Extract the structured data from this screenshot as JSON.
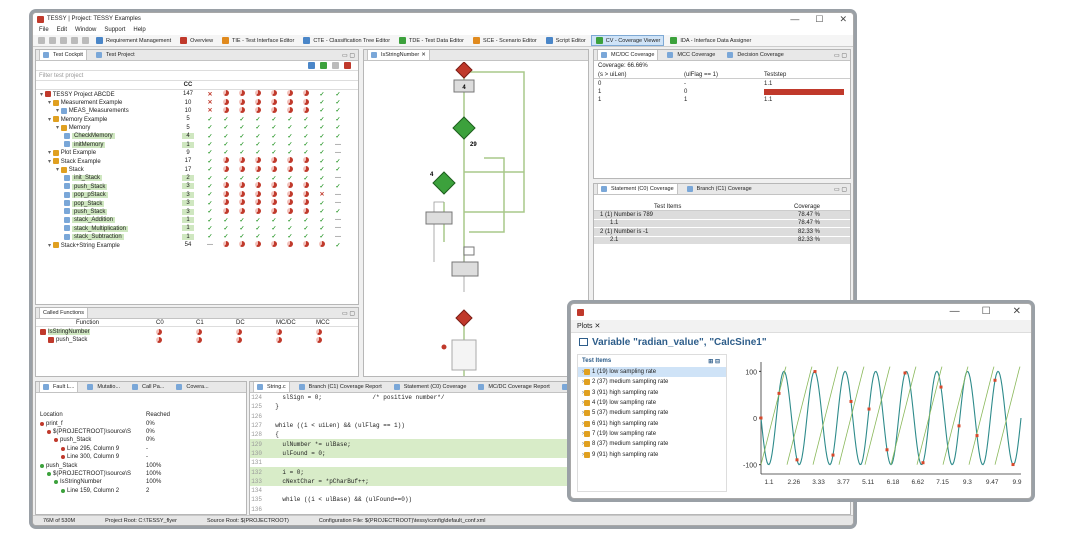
{
  "window": {
    "title": "TESSY | Project: TESSY Examples",
    "min": "—",
    "max": "☐",
    "close": "✕"
  },
  "menu": [
    "File",
    "Edit",
    "Window",
    "Support",
    "Help"
  ],
  "toolbar": {
    "perspectives": [
      "Requirement Management",
      "Overview",
      "TIE - Test Interface Editor",
      "CTE - Classification Tree Editor",
      "TDE - Test Data Editor",
      "SCE - Scenario Editor",
      "Script Editor",
      "CV - Coverage Viewer",
      "IDA - Interface Data Assigner"
    ],
    "active_index": 7
  },
  "cockpit": {
    "tabs": [
      "Test Cockpit",
      "Test Project"
    ],
    "filter_placeholder": "Filter test project",
    "headers": [
      "CC",
      "",
      "",
      "",
      "",
      "",
      "",
      "",
      ""
    ],
    "rows": [
      {
        "name": "TESSY Project ABCDE",
        "cc": "147",
        "level": 0,
        "icon": "proj",
        "cells": [
          "✕",
          "pie",
          "pie",
          "pie",
          "pie",
          "pie",
          "pie",
          "✓",
          "✓"
        ]
      },
      {
        "name": "Measurement Example",
        "cc": "10",
        "level": 1,
        "icon": "mod",
        "cells": [
          "✕",
          "pie",
          "pie",
          "pie",
          "pie",
          "pie",
          "pie",
          "✓",
          "✓"
        ]
      },
      {
        "name": "MEAS_Measurements",
        "cc": "10",
        "level": 2,
        "icon": "test",
        "cells": [
          "✕",
          "pie",
          "pie",
          "pie",
          "pie",
          "pie",
          "pie",
          "✓",
          "✓"
        ]
      },
      {
        "name": "Memory Example",
        "cc": "5",
        "level": 1,
        "icon": "mod",
        "cells": [
          "✓",
          "✓",
          "✓",
          "✓",
          "✓",
          "✓",
          "✓",
          "✓",
          "✓"
        ]
      },
      {
        "name": "Memory",
        "cc": "5",
        "level": 2,
        "icon": "mod",
        "cells": [
          "✓",
          "✓",
          "✓",
          "✓",
          "✓",
          "✓",
          "✓",
          "✓",
          "✓"
        ]
      },
      {
        "name": "CheckMemory",
        "cc": "4",
        "level": 3,
        "icon": "test",
        "hl": true,
        "cells": [
          "✓",
          "✓",
          "✓",
          "✓",
          "✓",
          "✓",
          "✓",
          "✓",
          "✓"
        ]
      },
      {
        "name": "initMemory",
        "cc": "1",
        "level": 3,
        "icon": "test",
        "hl": true,
        "cells": [
          "✓",
          "✓",
          "✓",
          "✓",
          "✓",
          "✓",
          "✓",
          "✓",
          "—"
        ]
      },
      {
        "name": "Plot Example",
        "cc": "9",
        "level": 1,
        "icon": "mod",
        "cells": [
          "✓",
          "✓",
          "✓",
          "✓",
          "✓",
          "✓",
          "✓",
          "✓",
          "—"
        ]
      },
      {
        "name": "Stack Example",
        "cc": "17",
        "level": 1,
        "icon": "mod",
        "cells": [
          "✓",
          "pie",
          "pie",
          "pie",
          "pie",
          "pie",
          "pie",
          "✓",
          "✓"
        ]
      },
      {
        "name": "Stack",
        "cc": "17",
        "level": 2,
        "icon": "mod",
        "cells": [
          "✓",
          "pie",
          "pie",
          "pie",
          "pie",
          "pie",
          "pie",
          "✓",
          "✓"
        ]
      },
      {
        "name": "init_Stack",
        "cc": "2",
        "level": 3,
        "icon": "test",
        "hl": true,
        "cells": [
          "✓",
          "✓",
          "✓",
          "✓",
          "✓",
          "✓",
          "✓",
          "✓",
          "—"
        ]
      },
      {
        "name": "push_Stack",
        "cc": "3",
        "level": 3,
        "icon": "test",
        "hl": true,
        "cells": [
          "✓",
          "pie",
          "pie",
          "pie",
          "pie",
          "pie",
          "pie",
          "✓",
          "✓"
        ]
      },
      {
        "name": "pop_pStack",
        "cc": "3",
        "level": 3,
        "icon": "test",
        "hl": true,
        "cells": [
          "✓",
          "pie",
          "pie",
          "pie",
          "pie",
          "pie",
          "pie",
          "✕",
          "—"
        ]
      },
      {
        "name": "pop_Stack",
        "cc": "3",
        "level": 3,
        "icon": "test",
        "hl": true,
        "cells": [
          "✓",
          "pie",
          "pie",
          "pie",
          "pie",
          "pie",
          "pie",
          "✓",
          "—"
        ]
      },
      {
        "name": "push_Stack",
        "cc": "3",
        "level": 3,
        "icon": "test",
        "hl": true,
        "cells": [
          "✓",
          "pie",
          "pie",
          "pie",
          "pie",
          "pie",
          "pie",
          "✓",
          "✓"
        ]
      },
      {
        "name": "stack_Addition",
        "cc": "1",
        "level": 3,
        "icon": "test",
        "hl": true,
        "cells": [
          "✓",
          "✓",
          "✓",
          "✓",
          "✓",
          "✓",
          "✓",
          "✓",
          "—"
        ]
      },
      {
        "name": "stack_Multiplication",
        "cc": "1",
        "level": 3,
        "icon": "test",
        "hl": true,
        "cells": [
          "✓",
          "✓",
          "✓",
          "✓",
          "✓",
          "✓",
          "✓",
          "✓",
          "—"
        ]
      },
      {
        "name": "stack_Subtraction",
        "cc": "1",
        "level": 3,
        "icon": "test",
        "hl": true,
        "cells": [
          "✓",
          "✓",
          "✓",
          "✓",
          "✓",
          "✓",
          "✓",
          "✓",
          "—"
        ]
      },
      {
        "name": "Stack+String Example",
        "cc": "54",
        "level": 1,
        "icon": "mod",
        "cells": [
          "—",
          "pie",
          "pie",
          "pie",
          "pie",
          "pie",
          "pie",
          "pie",
          "✓"
        ]
      }
    ]
  },
  "called": {
    "title": "Called Functions",
    "headers": [
      "Function",
      "C0",
      "C1",
      "DC",
      "MC/DC",
      "MCC"
    ],
    "rows": [
      {
        "name": "IsStringNumber"
      },
      {
        "name": "push_Stack"
      }
    ]
  },
  "flow": {
    "tab": "IsStringNumber",
    "node_labels": [
      "4",
      "29",
      "4"
    ]
  },
  "mcdc": {
    "tabs": [
      "MC/DC Coverage",
      "MCC Coverage",
      "Decision Coverage"
    ],
    "coverage": "Coverage: 66.66%",
    "headers": [
      "(s > uiLen)",
      "(ulFlag == 1)",
      "Teststep"
    ],
    "rows": [
      [
        "0",
        "-",
        "1.1"
      ],
      [
        "1",
        "0",
        ""
      ],
      [
        "1",
        "1",
        "1.1"
      ]
    ]
  },
  "branch": {
    "tabs": [
      "Statement (C0) Coverage",
      "Branch (C1) Coverage"
    ],
    "headers": [
      "Test Items",
      "Coverage"
    ],
    "rows": [
      [
        "1 (1) Number is 789",
        "78.47 %"
      ],
      [
        "1.1",
        "78.47 %"
      ],
      [
        "2 (1) Number is -1",
        "82.33 %"
      ],
      [
        "2.1",
        "82.33 %"
      ]
    ]
  },
  "bottomleft": {
    "tabs": [
      "Fault L...",
      "Mutatio...",
      "Call Pa...",
      "Covera..."
    ],
    "headers": [
      "Location",
      "Reached"
    ],
    "rows": [
      [
        "print_f",
        "0%"
      ],
      [
        "$(PROJECTROOT)\\source\\S",
        "0%"
      ],
      [
        "push_Stack",
        "0%"
      ],
      [
        "Line 295, Column 9",
        "-"
      ],
      [
        "Line 300, Column 9",
        "-"
      ],
      [
        "push_Stack",
        "100%"
      ],
      [
        "$(PROJECTROOT)\\source\\S",
        "100%"
      ],
      [
        "IsStringNumber",
        "100%"
      ],
      [
        "Line 159, Column 2",
        "2"
      ]
    ]
  },
  "editor": {
    "tabs": [
      "String.c",
      "Branch (C1) Coverage Report",
      "Statement (C0) Coverage",
      "MC/DC Coverage Report",
      "MCC"
    ],
    "lines": [
      {
        "n": "124",
        "t": "    slSign = 0;              /* positive number*/",
        "g": false
      },
      {
        "n": "125",
        "t": "  }",
        "g": false
      },
      {
        "n": "126",
        "t": "",
        "g": false
      },
      {
        "n": "127",
        "t": "  while ((i < uiLen) && (ulFlag == 1))",
        "g": false
      },
      {
        "n": "128",
        "t": "  {",
        "g": false
      },
      {
        "n": "129",
        "t": "    ulNumber *= ulBase;",
        "g": true
      },
      {
        "n": "130",
        "t": "    ulFound = 0;",
        "g": true
      },
      {
        "n": "131",
        "t": "",
        "g": false
      },
      {
        "n": "132",
        "t": "    i = 0;",
        "g": true
      },
      {
        "n": "133",
        "t": "    cNextChar = *pCharBuf++;",
        "g": true
      },
      {
        "n": "134",
        "t": "",
        "g": false
      },
      {
        "n": "135",
        "t": "    while ((i < ulBase) && (ulFound==0))",
        "g": false
      },
      {
        "n": "136",
        "t": "",
        "g": false
      }
    ]
  },
  "status": {
    "memory": "76M of 530M",
    "project_root": "Project Root: C:\\TESSY_flyer",
    "source_root": "Source Root: $(PROJECTROOT)",
    "config": "Configuration File: $(PROJECTROOT)\\tessy\\config\\default_conf.xml"
  },
  "plot": {
    "tab": "Plots",
    "title": "Variable \"radian_value\", \"CalcSine1\"",
    "list_title": "Test Items",
    "items": [
      "1 (19) low sampling rate",
      "2 (37) medium sampling rate",
      "3 (91) high sampling rate",
      "4 (19) low sampling rate",
      "5 (37) medium sampling rate",
      "6 (91) high sampling rate",
      "7 (19) low sampling rate",
      "8 (37) medium sampling rate",
      "9 (91) high sampling rate"
    ],
    "selected": 0
  },
  "chart_data": {
    "type": "line",
    "y_ticks": [
      "100",
      "0",
      "-100"
    ],
    "x_ticks": [
      "1.1",
      "2.26",
      "3.33",
      "3.77",
      "5.11",
      "6.18",
      "6.62",
      "7.15",
      "9.3",
      "9.47",
      "9.9"
    ],
    "ylim": [
      -120,
      120
    ],
    "series": [
      {
        "color": "#2e8b8b",
        "kind": "sine",
        "cycles": 8.5
      },
      {
        "color": "#8ab85a",
        "kind": "saw",
        "period": 1.1
      }
    ],
    "markers_color": "#d8482b"
  }
}
